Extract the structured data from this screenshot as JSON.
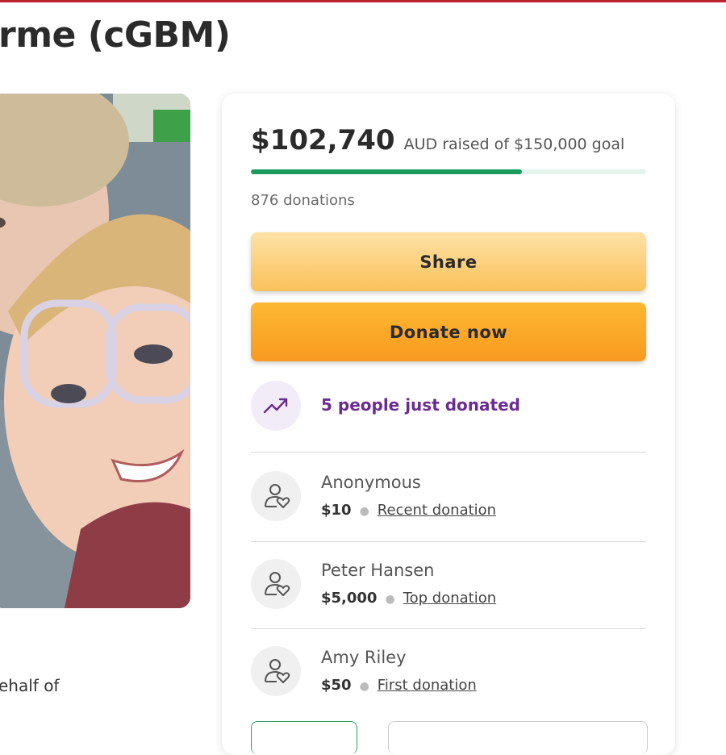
{
  "page": {
    "title": "rme (cGBM)",
    "story_snippet": "ehalf of"
  },
  "colors": {
    "brand_bar": "#b8232f",
    "progress": "#1a9a5b",
    "trend_text": "#6a2c91",
    "share_button": "#fbc15a",
    "donate_button": "#f89a1f"
  },
  "fundraiser": {
    "raised_amount": "$102,740",
    "raised_caption": "AUD raised of $150,000 goal",
    "progress_fraction": 0.685,
    "donations_count": "876 donations",
    "share_label": "Share",
    "donate_label": "Donate now",
    "trend_text": "5 people just donated",
    "trend_icon": "trending-up-icon"
  },
  "donations": [
    {
      "name": "Anonymous",
      "amount": "$10",
      "tag": "Recent donation",
      "icon": "donor-heart-icon"
    },
    {
      "name": "Peter Hansen",
      "amount": "$5,000",
      "tag": "Top donation",
      "icon": "donor-heart-icon"
    },
    {
      "name": "Amy Riley",
      "amount": "$50",
      "tag": "First donation",
      "icon": "donor-heart-icon"
    }
  ]
}
